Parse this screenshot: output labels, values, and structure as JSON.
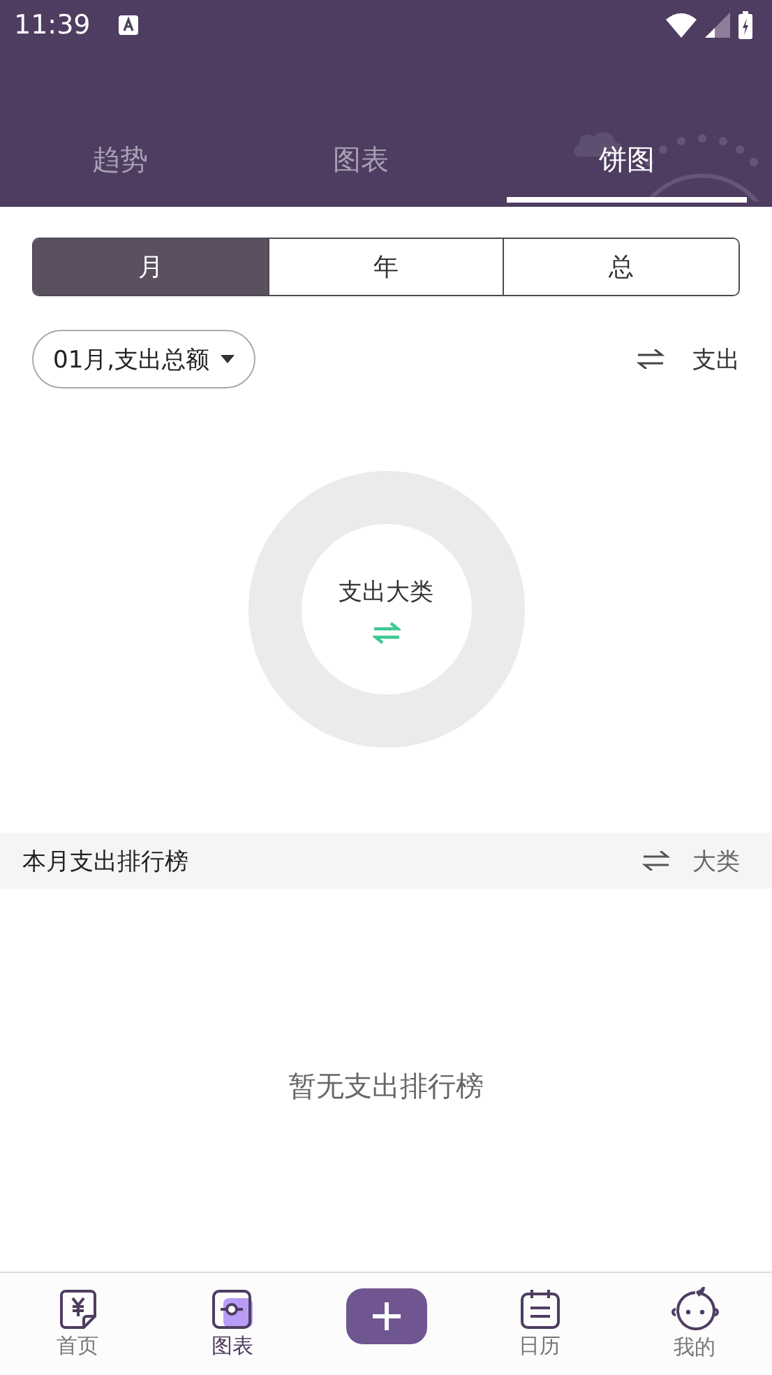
{
  "status_bar": {
    "time": "11:39"
  },
  "tabs": [
    {
      "label": "趋势",
      "selected": false
    },
    {
      "label": "图表",
      "selected": false
    },
    {
      "label": "饼图",
      "selected": true
    }
  ],
  "period": [
    {
      "label": "月",
      "selected": true
    },
    {
      "label": "年",
      "selected": false
    },
    {
      "label": "总",
      "selected": false
    }
  ],
  "filter": {
    "dropdown": "01月,支出总额",
    "toggle": "支出"
  },
  "donut": {
    "center_label": "支出大类"
  },
  "ranking": {
    "title": "本月支出排行榜",
    "toggle": "大类",
    "empty_text": "暂无支出排行榜"
  },
  "bottom_nav": [
    {
      "kind": "home",
      "label": "首页",
      "selected": false
    },
    {
      "kind": "chart",
      "label": "图表",
      "selected": true
    },
    {
      "kind": "add"
    },
    {
      "kind": "calendar",
      "label": "日历",
      "selected": false
    },
    {
      "kind": "profile",
      "label": "我的",
      "selected": false
    }
  ]
}
